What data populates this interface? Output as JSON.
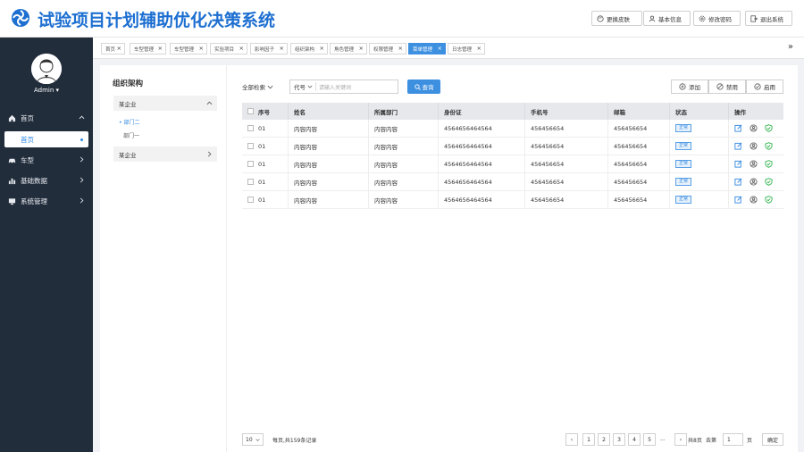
{
  "header": {
    "title": "试验项目计划辅助优化决策系统",
    "buttons": [
      "更换皮肤",
      "基本信息",
      "修改密码",
      "退出系统"
    ],
    "brand_color": "#1d6fd1"
  },
  "sidebar": {
    "user": "Admin",
    "items": [
      {
        "label": "首页",
        "icon": "home-icon"
      },
      {
        "label": "首页",
        "sub": true
      },
      {
        "label": "车型",
        "icon": "car-icon"
      },
      {
        "label": "基础数据",
        "icon": "bar-chart-icon"
      },
      {
        "label": "系统管理",
        "icon": "monitor-icon"
      }
    ]
  },
  "tabs": [
    "首页",
    "车型管理",
    "车型管理",
    "实验项目",
    "影响因子",
    "组织架构",
    "角色管理",
    "权限管理",
    "菜单管理",
    "日志管理"
  ],
  "active_tab_index": 8,
  "org": {
    "title": "组织架构",
    "company_1": "某企业",
    "dept_selected": "部门二",
    "dept_other": "部门一",
    "company_2": "某企业"
  },
  "search": {
    "scope": "全部检索",
    "field": "代号",
    "placeholder": "请输入关键词",
    "button": "查询"
  },
  "actions": [
    "添加",
    "禁用",
    "启用"
  ],
  "table": {
    "columns": [
      "序号",
      "姓名",
      "所属部门",
      "身份证",
      "手机号",
      "邮箱",
      "状态",
      "操作"
    ],
    "rows": [
      [
        "01",
        "内容内容",
        "内容内容",
        "4564656464564",
        "456456654",
        "456456654",
        "正常"
      ],
      [
        "01",
        "内容内容",
        "内容内容",
        "4564656464564",
        "456456654",
        "456456654",
        "正常"
      ],
      [
        "01",
        "内容内容",
        "内容内容",
        "4564656464564",
        "456456654",
        "456456654",
        "正常"
      ],
      [
        "01",
        "内容内容",
        "内容内容",
        "4564656464564",
        "456456654",
        "456456654",
        "正常"
      ],
      [
        "01",
        "内容内容",
        "内容内容",
        "4564656464564",
        "456456654",
        "456456654",
        "正常"
      ]
    ]
  },
  "pagination": {
    "page_size": "10",
    "info": "每页,共159条记录",
    "pages": [
      "1",
      "2",
      "3",
      "4",
      "5"
    ],
    "ellipsis": "...",
    "total_pages": "共8页",
    "goto_label": "去第",
    "goto_value": "1",
    "page_unit": "页",
    "confirm": "确定"
  }
}
